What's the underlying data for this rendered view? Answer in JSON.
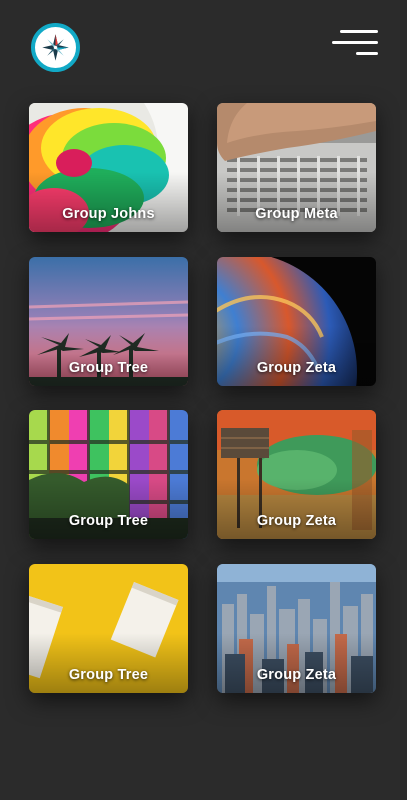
{
  "header": {
    "logo_icon": "compass-icon",
    "menu_icon": "hamburger-menu-icon"
  },
  "colors": {
    "background": "#2b2b2b",
    "logo_ring": "#12a9c6",
    "text": "#ffffff"
  },
  "groups": [
    {
      "label": "Group Johns",
      "image": "colorful chrysanthemum flower"
    },
    {
      "label": "Group Meta",
      "image": "hand over keyboard"
    },
    {
      "label": "Group Tree",
      "image": "palm trees at pink sunset"
    },
    {
      "label": "Group Zeta",
      "image": "colorful planet bubble"
    },
    {
      "label": "Group Tree",
      "image": "rainbow glass building facade"
    },
    {
      "label": "Group Zeta",
      "image": "weathered colorful wall art"
    },
    {
      "label": "Group Tree",
      "image": "boxed water cartons on yellow"
    },
    {
      "label": "Group Zeta",
      "image": "aerial city skyline"
    }
  ]
}
